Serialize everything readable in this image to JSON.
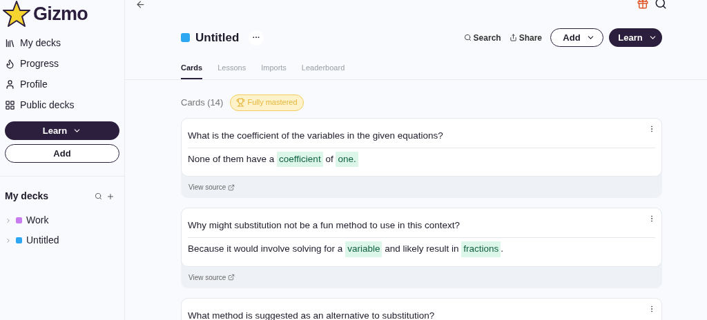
{
  "logo": {
    "text": "Gizmo"
  },
  "nav": [
    {
      "label": "My decks",
      "kind": "library"
    },
    {
      "label": "Progress",
      "kind": "flame"
    },
    {
      "label": "Profile",
      "kind": "user"
    },
    {
      "label": "Public decks",
      "kind": "grid"
    }
  ],
  "sidebar_buttons": [
    {
      "label": "Learn",
      "kind": "primary"
    },
    {
      "label": "Add",
      "kind": "outline"
    }
  ],
  "my_decks": {
    "title": "My decks",
    "items": [
      {
        "name": "Work",
        "color": "#c87cf0",
        "expanded": false
      },
      {
        "name": "Untitled",
        "color": "#2ea7f2",
        "expanded": false
      }
    ]
  },
  "deck": {
    "title": "Untitled",
    "color": "#2ea7f2",
    "more": "···"
  },
  "actions": [
    {
      "label": "Search",
      "kind": "search"
    },
    {
      "label": "Share",
      "kind": "share"
    },
    {
      "label": "Add",
      "kind": "outline"
    },
    {
      "label": "Learn",
      "kind": "primary"
    }
  ],
  "tabs": [
    {
      "label": "Cards",
      "selected": true
    },
    {
      "label": "Lessons",
      "selected": false
    },
    {
      "label": "Imports",
      "selected": false
    },
    {
      "label": "Leaderboard",
      "selected": false
    }
  ],
  "cards_count": "Cards (14)",
  "badge": "Fully mastered",
  "cards": [
    {
      "question": "What is the coefficient of the variables in the given equations?",
      "answer": [
        {
          "text": "None of them have a ",
          "highlight": false
        },
        {
          "text": "coefficient",
          "highlight": true
        },
        {
          "text": " of ",
          "highlight": false
        },
        {
          "text": "one.",
          "highlight": true
        }
      ],
      "source": "View source"
    },
    {
      "question": "Why might substitution not be a fun method to use in this context?",
      "answer": [
        {
          "text": "Because it would involve solving for a ",
          "highlight": false
        },
        {
          "text": "variable",
          "highlight": true
        },
        {
          "text": " and likely result in ",
          "highlight": false
        },
        {
          "text": "fractions",
          "highlight": true
        },
        {
          "text": ".",
          "highlight": false
        }
      ],
      "source": "View source"
    },
    {
      "question": "What method is suggested as an alternative to substitution?"
    }
  ]
}
